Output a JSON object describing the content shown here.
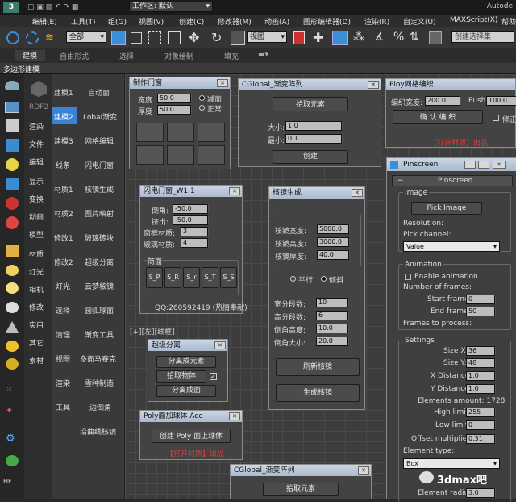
{
  "titlebar": {
    "workspace": "工作区: 默认",
    "right": "Autode"
  },
  "menu": [
    "编辑(E)",
    "工具(T)",
    "组(G)",
    "视图(V)",
    "创建(C)",
    "修改器(M)",
    "动画(A)",
    "图形编辑器(D)",
    "渲染(R)",
    "自定义(U)",
    "MAXScript(X)",
    "帮助"
  ],
  "toolbar": {
    "filter": "全部",
    "view": "视图",
    "selection_set": "创建选择集"
  },
  "ribbon": {
    "tabs": [
      "建模",
      "自由形式",
      "选择",
      "对象绘制",
      "填充"
    ],
    "sub": "多边形建模"
  },
  "side_labels": [
    "RDF2",
    "渲染",
    "文件",
    "编辑",
    "显示",
    "变换",
    "动画",
    "模型",
    "材质",
    "灯光",
    "相机",
    "修改",
    "实用",
    "其它",
    "素材"
  ],
  "col1": [
    "建模1",
    "建模2",
    "建模3",
    "线条",
    "材质1",
    "材质2",
    "修改1",
    "修改2",
    "灯光",
    "选择",
    "清理",
    "视图",
    "渲染",
    "工具"
  ],
  "col2": [
    "自动窗",
    "Lobal渐变",
    "网格编辑",
    "闪电门窗",
    "核镜生成",
    "图片映射",
    "玻璃砖块",
    "超级分离",
    "云梦核镜",
    "圆弧球面",
    "渐变工具",
    "多面马赛克",
    "雪种制造",
    "边倒角",
    "沿曲线核镜"
  ],
  "door": {
    "title": "制作门窗",
    "width_label": "宽度",
    "width": "50.0",
    "thick_label": "厚度",
    "thick": "50.0",
    "opt1": "减面",
    "opt2": "正常"
  },
  "lightning": {
    "title": "闪电门窗_W1.1",
    "f1": "倒角:",
    "v1": "-50.0",
    "f2": "挤出:",
    "v2": "-50.0",
    "f3": "窗框材质:",
    "v3": "3",
    "f4": "玻璃材质:",
    "v4": "4",
    "group": "简面",
    "btns": [
      "S_P",
      "S_R",
      "S_r",
      "S_T",
      "S_S"
    ],
    "qq": "QQ:260592419 (热情奉献)"
  },
  "cglobal": {
    "title": "CGlobal_渐变阵列",
    "pick": "拾取元素",
    "size_label": "大小:",
    "size": "1.0",
    "min_label": "最小:",
    "min": "0.1",
    "create": "创建"
  },
  "ploy": {
    "title": "Ploy网格编织",
    "width_label": "编织宽度:",
    "width": "200.0",
    "push_label": "Push:",
    "push": "100.0",
    "confirm": "确 认 编 织",
    "fix": "修正",
    "red": "【打开材质】出品"
  },
  "mirror": {
    "title": "核镜生成",
    "f": [
      "核镜宽度:",
      "核镜高度:",
      "核镜厚度:"
    ],
    "v": [
      "5000.0",
      "3000.0",
      "40.0"
    ],
    "r1": "平行",
    "r2": "倾斜",
    "g": [
      "宽分段数:",
      "高分段数:",
      "倒角高度:",
      "倒角大小:"
    ],
    "gv": [
      "10",
      "6",
      "10.0",
      "20.0"
    ],
    "refresh": "刷新核镜",
    "gen": "生成核镜"
  },
  "viewport_label": "[+][左][线框]",
  "superdetach": {
    "title": "超级分离",
    "b1": "分离成元素",
    "b2": "拾取物体",
    "b3": "分离成面"
  },
  "polyball": {
    "title": "Poly面加球体 Ace",
    "btn": "创建 Poly 面上球体",
    "red": "【打开材质】出品"
  },
  "cglobal2": {
    "title": "CGlobal_渐变阵列",
    "pick": "拾取元素"
  },
  "pinscreen": {
    "title": "Pinscreen",
    "rollout": "Pinscreen",
    "image": "Image",
    "pick_image": "Pick Image",
    "resolution": "Resolution:",
    "pick_channel": "Pick channel:",
    "channel": "Value",
    "animation": "Animation",
    "enable_anim": "Enable animation",
    "num_frames": "Number of frames:",
    "start_frame_label": "Start frame:",
    "start_frame": "0",
    "end_frame_label": "End frame:",
    "end_frame": "50",
    "frames_process": "Frames to process:",
    "settings": "Settings",
    "sizex_label": "Size X:",
    "sizex": "36",
    "sizey_label": "Size Y:",
    "sizey": "48",
    "xdist_label": "X Distance:",
    "xdist": "1.0",
    "ydist_label": "Y Distance:",
    "ydist": "1.0",
    "elements": "Elements amount: 1728",
    "high_label": "High limit:",
    "high": "255",
    "low_label": "Low limit:",
    "low": "0",
    "offset_label": "Offset multiplier:",
    "offset": "0.31",
    "etype_label": "Element type:",
    "etype": "Box",
    "eradius_label": "Element radius:",
    "eradius": "3.0"
  },
  "watermark": "3dmax吧"
}
